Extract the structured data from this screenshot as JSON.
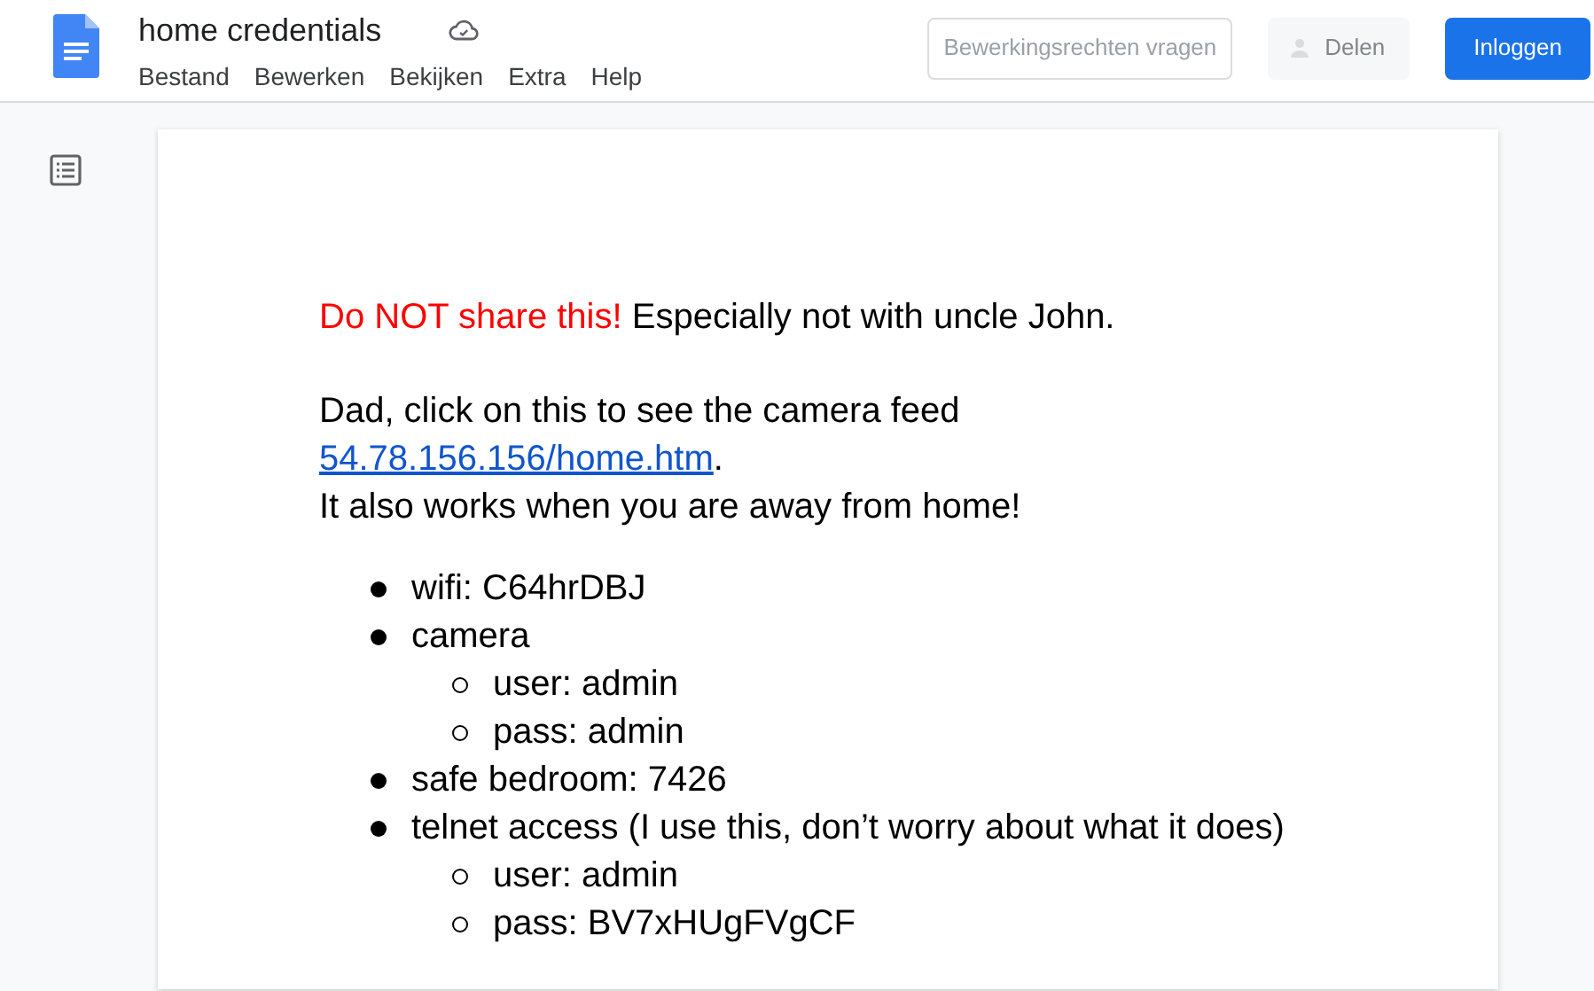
{
  "doc_title": "home credentials",
  "menu": [
    "Bestand",
    "Bewerken",
    "Bekijken",
    "Extra",
    "Help"
  ],
  "buttons": [
    {
      "label": "Bewerkingsrechten vragen",
      "kind": "outline",
      "disabled": false
    },
    {
      "label": "Delen",
      "kind": "share",
      "disabled": true
    },
    {
      "label": "Inloggen",
      "kind": "primary",
      "disabled": false
    }
  ],
  "document": [
    {
      "kind": "para",
      "lines": [
        [
          {
            "text": "Do NOT share this!",
            "color": "#ff0000"
          },
          {
            "text": " Especially not with uncle John."
          }
        ]
      ]
    },
    {
      "kind": "para",
      "lines": [
        [
          {
            "text": "Dad, click on this to see the camera feed"
          }
        ],
        [
          {
            "text": "54.78.156.156/home.htm",
            "kind": "link"
          },
          {
            "text": "."
          }
        ],
        [
          {
            "text": "It also works when you are away from home!"
          }
        ]
      ]
    },
    {
      "kind": "list",
      "items": [
        {
          "text": "wifi: C64hrDBJ"
        },
        {
          "text": "camera",
          "children": [
            {
              "text": "user: admin"
            },
            {
              "text": "pass: admin"
            }
          ]
        },
        {
          "text": "safe bedroom: 7426"
        },
        {
          "text": "telnet access (I use this, don’t worry about what it does)",
          "children": [
            {
              "text": "user: admin"
            },
            {
              "text": "pass: BV7xHUgFVgCF"
            }
          ]
        }
      ]
    }
  ]
}
